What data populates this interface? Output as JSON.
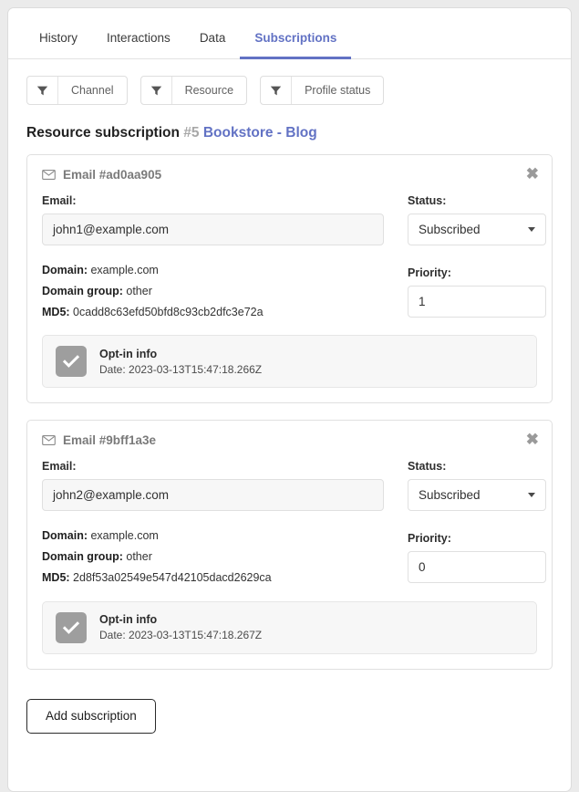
{
  "tabs": [
    {
      "label": "History",
      "active": false
    },
    {
      "label": "Interactions",
      "active": false
    },
    {
      "label": "Data",
      "active": false
    },
    {
      "label": "Subscriptions",
      "active": true
    }
  ],
  "filters": [
    {
      "icon": "filter-icon",
      "label": "Channel"
    },
    {
      "icon": "filter-icon",
      "label": "Resource"
    },
    {
      "icon": "filter-icon",
      "label": "Profile status"
    }
  ],
  "heading": {
    "title": "Resource subscription",
    "number": "#5",
    "link": "Bookstore - Blog"
  },
  "labels": {
    "email": "Email:",
    "status": "Status:",
    "domain": "Domain:",
    "domain_group": "Domain group:",
    "md5": "MD5:",
    "priority": "Priority:",
    "optin_title": "Opt-in info",
    "date_prefix": "Date:"
  },
  "cards": [
    {
      "title": "Email #ad0aa905",
      "email": "john1@example.com",
      "status": "Subscribed",
      "domain": "example.com",
      "domain_group": "other",
      "md5": "0cadd8c63efd50bfd8c93cb2dfc3e72a",
      "priority": "1",
      "optin_date": "Date: 2023-03-13T15:47:18.266Z"
    },
    {
      "title": "Email #9bff1a3e",
      "email": "john2@example.com",
      "status": "Subscribed",
      "domain": "example.com",
      "domain_group": "other",
      "md5": "2d8f53a02549e547d42105dacd2629ca",
      "priority": "0",
      "optin_date": "Date: 2023-03-13T15:47:18.267Z"
    }
  ],
  "footer": {
    "add_label": "Add subscription"
  },
  "colors": {
    "accent": "#6272c4",
    "muted": "#a8a8a8",
    "checkbox": "#9e9e9e"
  }
}
